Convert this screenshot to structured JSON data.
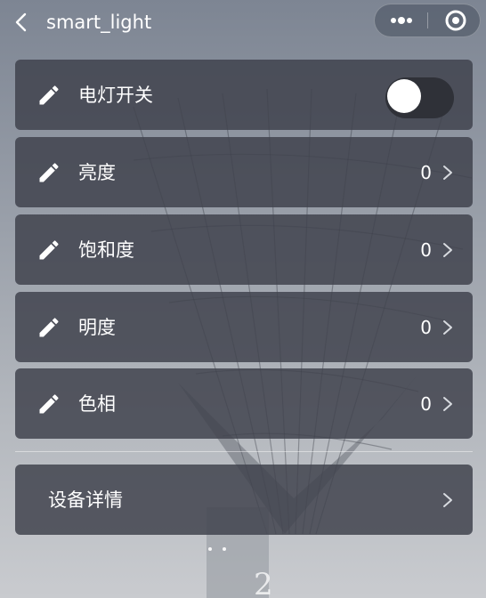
{
  "header": {
    "title": "smart_light",
    "back_icon": "chevron-left-icon",
    "capsule": {
      "more_icon": "more-dots-icon",
      "close_icon": "target-close-icon"
    }
  },
  "controls": [
    {
      "label": "电灯开关",
      "type": "toggle",
      "on": false
    },
    {
      "label": "亮度",
      "type": "value",
      "value": "0"
    },
    {
      "label": "饱和度",
      "type": "value",
      "value": "0"
    },
    {
      "label": "明度",
      "type": "value",
      "value": "0"
    },
    {
      "label": "色相",
      "type": "value",
      "value": "0"
    }
  ],
  "detail": {
    "label": "设备详情"
  },
  "colors": {
    "card_bg": "#3f424c",
    "text": "#ffffff",
    "toggle_off_track": "#2f3138"
  }
}
